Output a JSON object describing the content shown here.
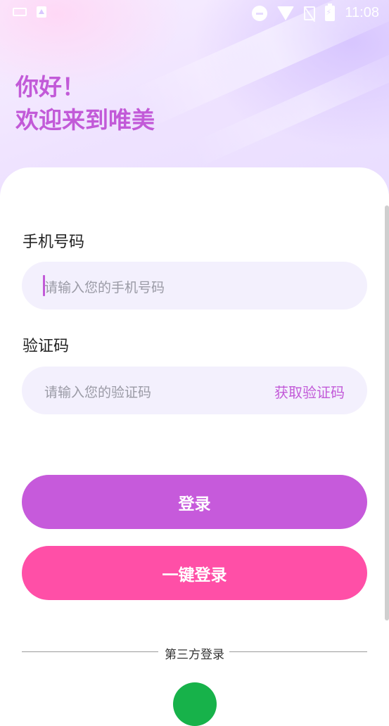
{
  "status_bar": {
    "time": "11:08"
  },
  "header": {
    "greeting_line1": "你好！",
    "greeting_line2": "欢迎来到唯美"
  },
  "form": {
    "phone_label": "手机号码",
    "phone_placeholder": "请输入您的手机号码",
    "code_label": "验证码",
    "code_placeholder": "请输入您的验证码",
    "get_code": "获取验证码"
  },
  "buttons": {
    "login": "登录",
    "one_key_login": "一键登录"
  },
  "third_party": {
    "title": "第三方登录"
  },
  "colors": {
    "accent": "#c65adb",
    "pink": "#ff4fa7",
    "field_bg": "#f3f0fd"
  }
}
